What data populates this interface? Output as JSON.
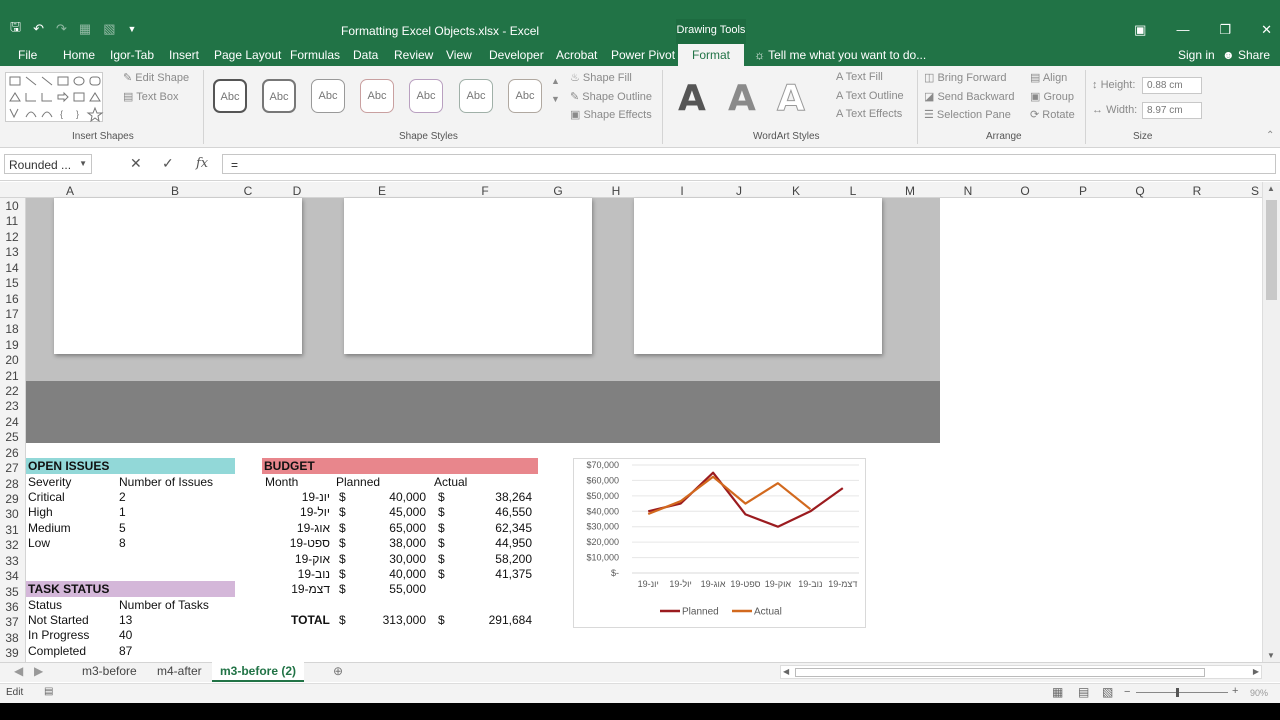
{
  "window": {
    "title": "Formatting Excel Objects.xlsx - Excel",
    "context_tab": "Drawing Tools",
    "sign_in": "Sign in",
    "share": "Share",
    "tell_me": "Tell me what you want to do..."
  },
  "tabs": [
    "File",
    "Home",
    "Igor-Tab",
    "Insert",
    "Page Layout",
    "Formulas",
    "Data",
    "Review",
    "View",
    "Developer",
    "Acrobat",
    "Power Pivot"
  ],
  "active_tab": "Format",
  "ribbon": {
    "insert_shapes": {
      "label": "Insert Shapes",
      "edit_shape": "Edit Shape",
      "text_box": "Text Box"
    },
    "shape_styles": {
      "label": "Shape Styles",
      "style_sample": "Abc",
      "fill": "Shape Fill",
      "outline": "Shape Outline",
      "effects": "Shape Effects"
    },
    "wordart": {
      "label": "WordArt Styles",
      "letter": "A",
      "fill": "Text Fill",
      "outline": "Text Outline",
      "effects": "Text Effects"
    },
    "arrange": {
      "label": "Arrange",
      "bring_forward": "Bring Forward",
      "send_backward": "Send Backward",
      "selection_pane": "Selection Pane",
      "align": "Align",
      "group": "Group",
      "rotate": "Rotate"
    },
    "size": {
      "label": "Size",
      "height_label": "Height:",
      "height": "0.88 cm",
      "width_label": "Width:",
      "width": "8.97 cm"
    }
  },
  "formula_bar": {
    "name_box": "Rounded ...",
    "formula": "=",
    "fx": "fx"
  },
  "columns": [
    "A",
    "B",
    "C",
    "D",
    "E",
    "F",
    "G",
    "H",
    "I",
    "J",
    "K",
    "L",
    "M",
    "N",
    "O",
    "P",
    "Q",
    "R",
    "S"
  ],
  "rows": [
    "10",
    "11",
    "12",
    "13",
    "14",
    "15",
    "16",
    "17",
    "18",
    "19",
    "20",
    "21",
    "22",
    "23",
    "24",
    "25",
    "26",
    "27",
    "28",
    "29",
    "30",
    "31",
    "32",
    "33",
    "34",
    "35",
    "36",
    "37",
    "38",
    "39"
  ],
  "open_issues": {
    "title": "OPEN ISSUES",
    "headers": [
      "Severity",
      "Number of Issues"
    ],
    "rows": [
      [
        "Critical",
        "2"
      ],
      [
        "High",
        "1"
      ],
      [
        "Medium",
        "5"
      ],
      [
        "Low",
        "8"
      ]
    ]
  },
  "task_status": {
    "title": "TASK STATUS",
    "headers": [
      "Status",
      "Number of Tasks"
    ],
    "rows": [
      [
        "Not Started",
        "13"
      ],
      [
        "In Progress",
        "40"
      ],
      [
        "Completed",
        "87"
      ]
    ]
  },
  "budget": {
    "title": "BUDGET",
    "headers": [
      "Month",
      "Planned",
      "Actual"
    ],
    "currency": "$",
    "rows": [
      {
        "month": "יונ-19",
        "planned": "40,000",
        "actual": "38,264"
      },
      {
        "month": "יול-19",
        "planned": "45,000",
        "actual": "46,550"
      },
      {
        "month": "אוג-19",
        "planned": "65,000",
        "actual": "62,345"
      },
      {
        "month": "ספט-19",
        "planned": "38,000",
        "actual": "44,950"
      },
      {
        "month": "אוק-19",
        "planned": "30,000",
        "actual": "58,200"
      },
      {
        "month": "נוב-19",
        "planned": "40,000",
        "actual": "41,375"
      },
      {
        "month": "דצמ-19",
        "planned": "55,000",
        "actual": ""
      }
    ],
    "total_label": "TOTAL",
    "total_planned": "313,000",
    "total_actual": "291,684"
  },
  "chart_data": {
    "type": "line",
    "categories": [
      "יונ-19",
      "יול-19",
      "אוג-19",
      "ספט-19",
      "אוק-19",
      "נוב-19",
      "דצמ-19"
    ],
    "series": [
      {
        "name": "Planned",
        "values": [
          40000,
          45000,
          65000,
          38000,
          30000,
          40000,
          55000
        ],
        "color": "#9b1b1f"
      },
      {
        "name": "Actual",
        "values": [
          38264,
          46550,
          62345,
          44950,
          58200,
          41375,
          null
        ],
        "color": "#d2691e"
      }
    ],
    "ytick_labels": [
      "$-",
      "$10,000",
      "$20,000",
      "$30,000",
      "$40,000",
      "$50,000",
      "$60,000",
      "$70,000"
    ],
    "ylim": [
      0,
      70000
    ],
    "legend_position": "bottom"
  },
  "sheets": [
    "m3-before",
    "m4-after",
    "m3-before (2)"
  ],
  "active_sheet": "m3-before (2)",
  "status": {
    "mode": "Edit",
    "zoom": "90%"
  },
  "colors": {
    "excel_green": "#217346",
    "open_issues": "#92d8d8",
    "budget": "#e8868c",
    "task_status": "#d4b7d9"
  }
}
